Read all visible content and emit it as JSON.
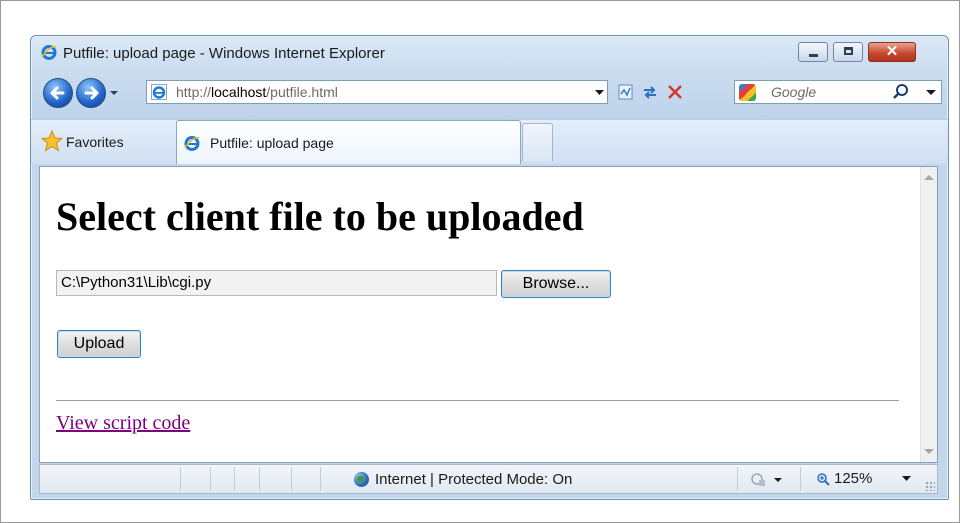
{
  "window": {
    "title": "Putfile: upload page - Windows Internet Explorer"
  },
  "navbar": {
    "address_prefix": "http://",
    "address_host": "localhost",
    "address_path": "/putfile.html",
    "search_placeholder": "Google"
  },
  "tabs": {
    "favorites_label": "Favorites",
    "active_tab_title": "Putfile: upload page"
  },
  "page": {
    "heading": "Select client file to be uploaded",
    "file_input_value": "C:\\Python31\\Lib\\cgi.py",
    "browse_label": "Browse...",
    "upload_label": "Upload",
    "link_text": "View script code",
    "link_color": "#800080"
  },
  "status": {
    "zone_text": "Internet | Protected Mode: On",
    "zoom_text": "125%"
  },
  "icons": [
    "ie-icon",
    "back-icon",
    "forward-icon",
    "refresh-icon",
    "compat-icon",
    "stop-icon",
    "search-icon",
    "star-icon",
    "globe-icon",
    "zoom-icon"
  ]
}
